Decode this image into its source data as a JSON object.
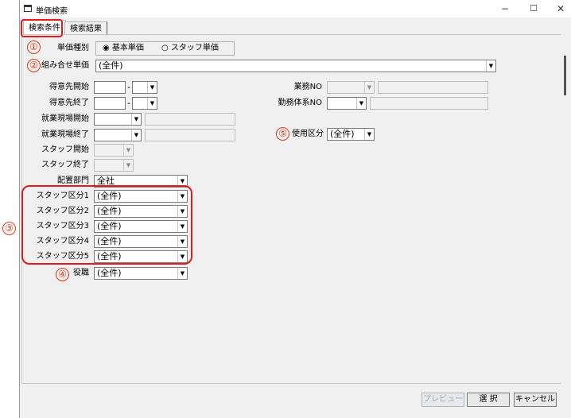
{
  "window": {
    "title": "単価検索",
    "minimize": "−",
    "maximize": "☐",
    "close": "✕"
  },
  "tabs": [
    {
      "label": "検索条件"
    },
    {
      "label": "検索結果"
    }
  ],
  "form": {
    "price_type": {
      "label": "単価種別",
      "options": [
        "基本単価",
        "スタッフ単価"
      ],
      "selected": 0
    },
    "combination_price": {
      "label": "組み合せ単価",
      "value": "(全件)"
    },
    "client_start": {
      "label": "得意先開始",
      "dash": "-"
    },
    "client_end": {
      "label": "得意先終了",
      "dash": "-"
    },
    "site_start": {
      "label": "就業現場開始"
    },
    "site_end": {
      "label": "就業現場終了"
    },
    "staff_start": {
      "label": "スタッフ開始"
    },
    "staff_end": {
      "label": "スタッフ終了"
    },
    "department": {
      "label": "配置部門",
      "value": "全社"
    },
    "staff_categories": [
      {
        "label": "スタッフ区分1",
        "value": "(全件)"
      },
      {
        "label": "スタッフ区分2",
        "value": "(全件)"
      },
      {
        "label": "スタッフ区分3",
        "value": "(全件)"
      },
      {
        "label": "スタッフ区分4",
        "value": "(全件)"
      },
      {
        "label": "スタッフ区分5",
        "value": "(全件)"
      }
    ],
    "position": {
      "label": "役職",
      "value": "(全件)"
    },
    "business_no": {
      "label": "業務NO"
    },
    "work_system_no": {
      "label": "勤務体系NO"
    },
    "usage_category": {
      "label": "使用区分",
      "value": "(全件)"
    }
  },
  "buttons": {
    "preview": "プレビュー",
    "select": "選 択",
    "cancel": "キャンセル"
  },
  "annotations": [
    "①",
    "②",
    "③",
    "④",
    "⑤"
  ],
  "colors": {
    "highlight": "#e8191c",
    "background": "#f0f0f0"
  }
}
